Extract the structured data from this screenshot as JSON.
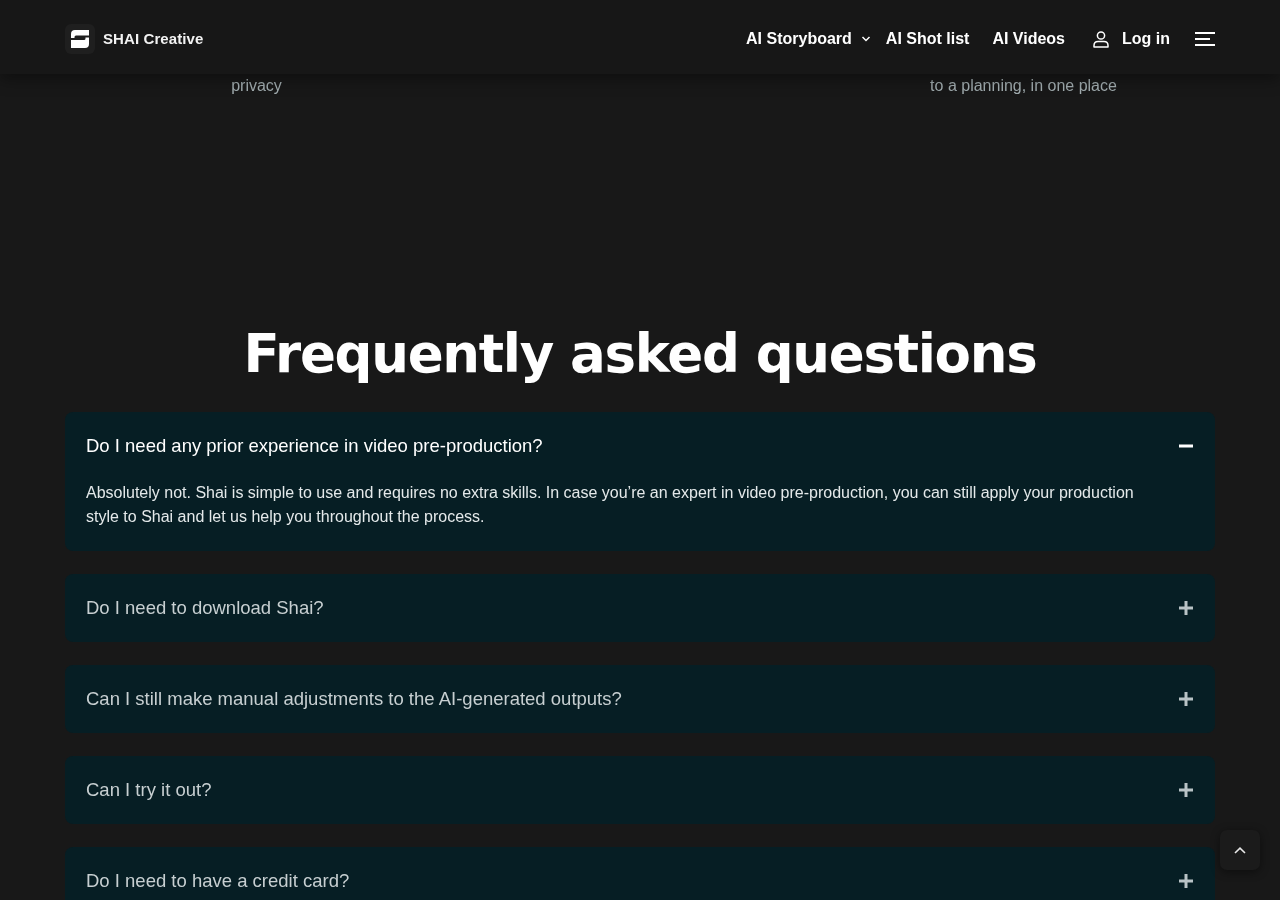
{
  "navbar": {
    "brand": "SHAI Creative",
    "links": [
      {
        "label": "AI Storyboard",
        "kind": "dropdown"
      },
      {
        "label": "AI Shot list",
        "kind": "link"
      },
      {
        "label": "AI Videos",
        "kind": "link"
      },
      {
        "label": "Log in",
        "kind": "account"
      }
    ]
  },
  "previous_section": {
    "captions": [
      "privacy",
      "to a planning, in one place"
    ]
  },
  "faq": {
    "title": "Frequently asked questions",
    "items": [
      {
        "question": "Do I need any prior experience in video pre-production?",
        "answer": "Absolutely not. Shai is simple to use and requires no extra skills. In case you’re an expert in video pre-production, you can still apply your production style to Shai and let us help you throughout the process.",
        "expanded": true
      },
      {
        "question": "Do I need to download Shai?",
        "expanded": false
      },
      {
        "question": "Can I still make manual adjustments to the AI-generated outputs?",
        "expanded": false
      },
      {
        "question": "Can I try it out?",
        "expanded": false
      },
      {
        "question": "Do I need to have a credit card?",
        "expanded": false
      }
    ]
  }
}
